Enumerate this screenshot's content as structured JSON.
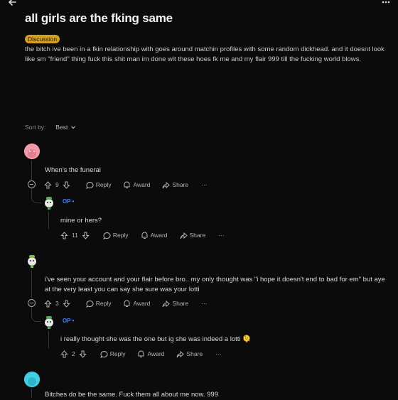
{
  "post": {
    "title": "all girls are the fking same",
    "flair": "Discussion",
    "body": "the bitch ive been in a fkin relationship with goes around matchin profiles with some random dickhead. and it doesnt look like sm \"friend\" thing fuck this shit man im done wit these hoes fk me and my flair 999 till the fucking world blows."
  },
  "sort": {
    "label": "Sort by:",
    "value": "Best"
  },
  "actions": {
    "reply": "Reply",
    "award": "Award",
    "share": "Share",
    "more": "···"
  },
  "comments": [
    {
      "text": "When's the funeral",
      "votes": "9",
      "reply": {
        "author": "OP •",
        "text": "mine or hers?",
        "votes": "11"
      }
    },
    {
      "text": "i've seen your account and your flair before bro.. my only thought was \"i hope it doesn't end to bad for em\" but aye at the very least you can say she sure was your lotti",
      "votes": "3",
      "reply": {
        "author": "OP •",
        "text": "i really thought she was the one but ig she was indeed a lotti 🫠",
        "votes": "2"
      }
    },
    {
      "text": "Bitches do be the same. Fuck them all about me now. 999"
    }
  ],
  "colors": {
    "accent": "#3d86f5",
    "flair": "#d4a017",
    "background": "#0b0b0c"
  }
}
